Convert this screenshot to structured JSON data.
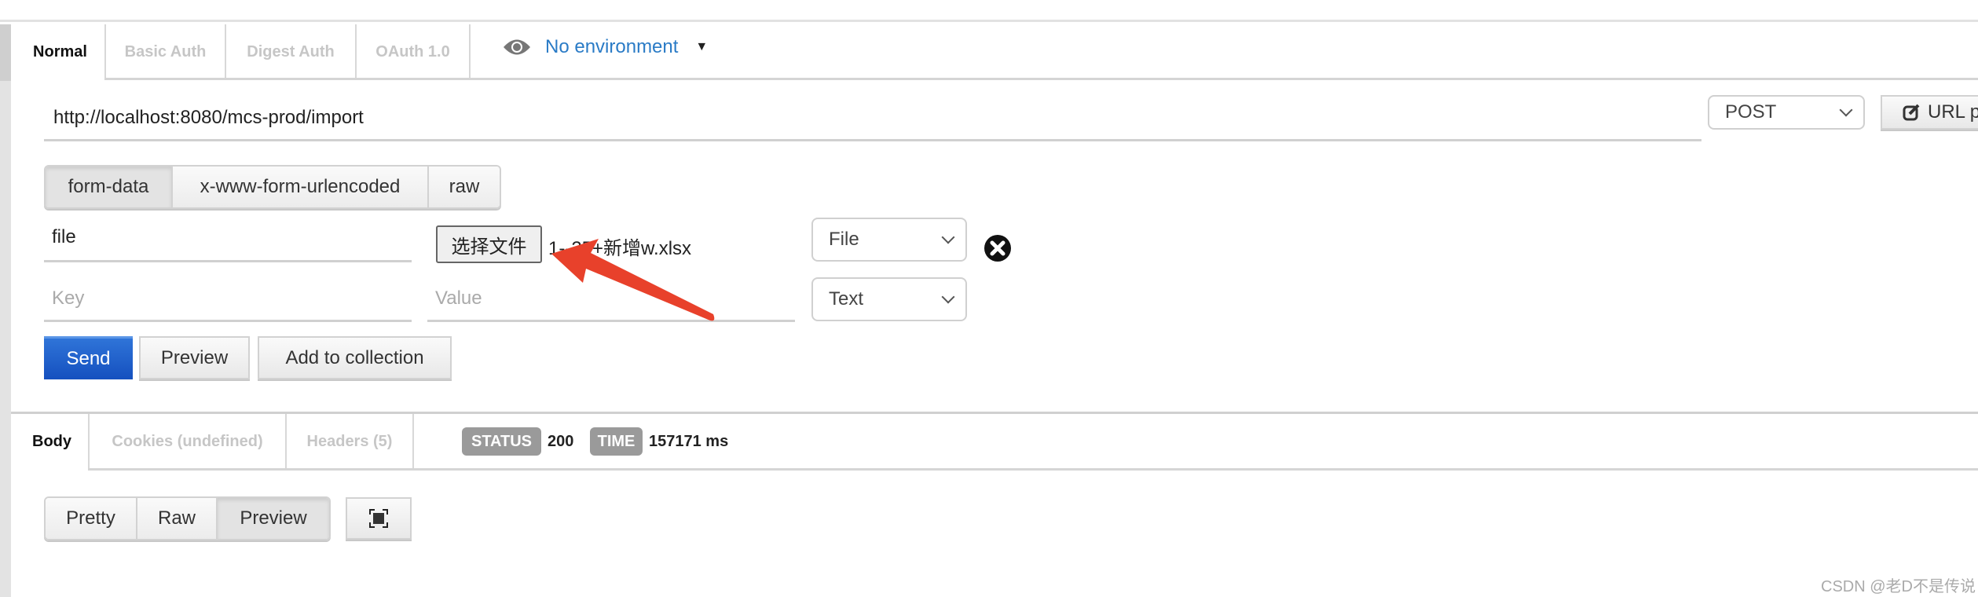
{
  "request_tabs": [
    {
      "label": "Normal",
      "active": true
    },
    {
      "label": "Basic Auth"
    },
    {
      "label": "Digest Auth"
    },
    {
      "label": "OAuth 1.0"
    }
  ],
  "environment": {
    "icon": "eye-icon",
    "label": "No environment"
  },
  "url": {
    "value": "http://localhost:8080/mcs-prod/import"
  },
  "method": {
    "selected": "POST"
  },
  "url_params_button": {
    "icon": "edit-icon",
    "label": "URL p"
  },
  "body_types": [
    {
      "label": "form-data",
      "active": true
    },
    {
      "label": "x-www-form-urlencoded"
    },
    {
      "label": "raw"
    }
  ],
  "form_rows": [
    {
      "key": "file",
      "choose_file_label": "选择文件",
      "file_name": "1--25+新增w.xlsx",
      "type": "File"
    },
    {
      "key_placeholder": "Key",
      "value_placeholder": "Value",
      "type": "Text"
    }
  ],
  "actions": {
    "send": "Send",
    "preview": "Preview",
    "add_to_collection": "Add to collection"
  },
  "response_tabs": [
    {
      "label": "Body",
      "active": true
    },
    {
      "label": "Cookies (undefined)"
    },
    {
      "label": "Headers (5)"
    }
  ],
  "status": {
    "status_label": "STATUS",
    "status_value": "200",
    "time_label": "TIME",
    "time_value": "157171 ms"
  },
  "view_modes": [
    {
      "label": "Pretty"
    },
    {
      "label": "Raw"
    },
    {
      "label": "Preview",
      "active": true
    }
  ],
  "fullscreen_icon": "fullscreen-icon",
  "watermark": "CSDN @老D不是传说",
  "colors": {
    "send": "#1a5bc8",
    "link": "#2a7bc6",
    "annotation_arrow": "#e8412b",
    "badge": "#9a9a9a"
  }
}
